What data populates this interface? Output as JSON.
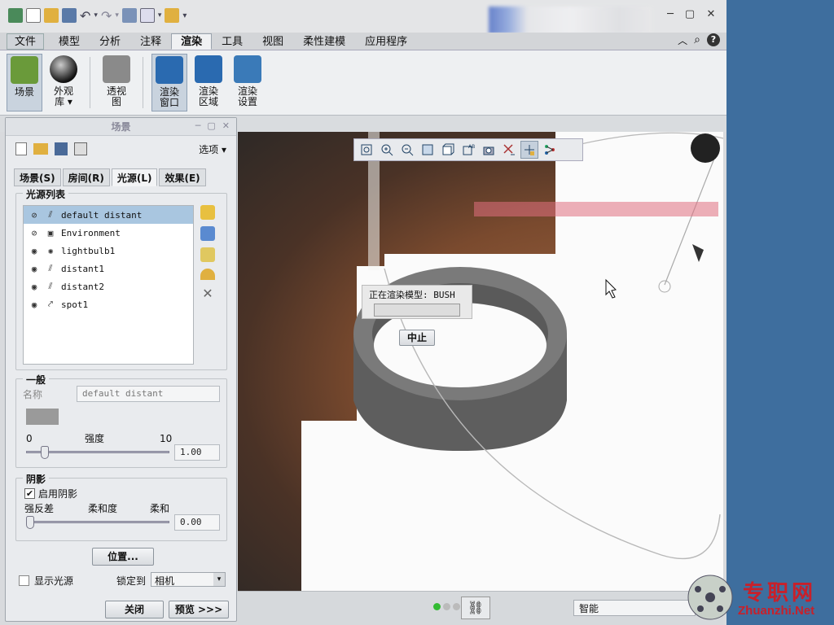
{
  "app": {
    "ribbon_tabs": [
      {
        "label": "文件",
        "file": true
      },
      {
        "label": "模型"
      },
      {
        "label": "分析"
      },
      {
        "label": "注释"
      },
      {
        "label": "渲染",
        "active": true
      },
      {
        "label": "工具"
      },
      {
        "label": "视图"
      },
      {
        "label": "柔性建模"
      },
      {
        "label": "应用程序"
      }
    ],
    "ribbon_buttons": [
      {
        "name": "scene",
        "line1": "场景",
        "line2": "",
        "selected": true,
        "color": "#6a9a3a"
      },
      {
        "name": "appearance-library",
        "line1": "外观",
        "line2": "库 ▾",
        "selected": false,
        "color": "#222"
      },
      {
        "name": "perspective",
        "line1": "透视",
        "line2": "图",
        "selected": false,
        "color": "#8a8a8a"
      },
      {
        "name": "render-window",
        "line1": "渲染",
        "line2": "窗口",
        "selected": true,
        "color": "#2a6ab0"
      },
      {
        "name": "render-region",
        "line1": "渲染",
        "line2": "区域",
        "selected": false,
        "color": "#2a6ab0"
      },
      {
        "name": "render-setup",
        "line1": "渲染",
        "line2": "设置",
        "selected": false,
        "color": "#3a7ab8"
      }
    ]
  },
  "rendering": {
    "progress_label": "正在渲染模型:  BUSH",
    "stop_button": "中止"
  },
  "status_bar": {
    "filter_value": "智能"
  },
  "scene_panel": {
    "title": "场景",
    "options_label": "选项",
    "tabs": [
      {
        "label": "场景(S)"
      },
      {
        "label": "房间(R)"
      },
      {
        "label": "光源(L)",
        "active": true
      },
      {
        "label": "效果(E)"
      }
    ],
    "light_list_title": "光源列表",
    "lights": [
      {
        "name": "default distant",
        "visible": false,
        "selected": true,
        "type": "distant"
      },
      {
        "name": "Environment",
        "visible": false,
        "selected": false,
        "type": "environment"
      },
      {
        "name": "lightbulb1",
        "visible": true,
        "selected": false,
        "type": "bulb"
      },
      {
        "name": "distant1",
        "visible": true,
        "selected": false,
        "type": "distant"
      },
      {
        "name": "distant2",
        "visible": true,
        "selected": false,
        "type": "distant"
      },
      {
        "name": "spot1",
        "visible": true,
        "selected": false,
        "type": "spot"
      }
    ],
    "general": {
      "title": "一般",
      "name_label": "名称",
      "name_value": "default distant",
      "color": "#9a9a9a",
      "intensity_label": "强度",
      "intensity_min": "0",
      "intensity_max": "10",
      "intensity_value": "1.00",
      "intensity_fraction": 0.1
    },
    "shadow": {
      "title": "阴影",
      "enable_label": "启用阴影",
      "enabled": true,
      "sharp_label": "强反差",
      "medium_label": "柔和度",
      "soft_label": "柔和",
      "softness_value": "0.00",
      "softness_fraction": 0.0
    },
    "position_button": "位置...",
    "show_lights_label": "显示光源",
    "lock_to_label": "锁定到",
    "lock_to_value": "相机",
    "close_button": "关闭",
    "preview_button": "预览 >>>"
  },
  "watermark": {
    "cn": "专职网",
    "en": "Zhuanzhi.Net"
  }
}
